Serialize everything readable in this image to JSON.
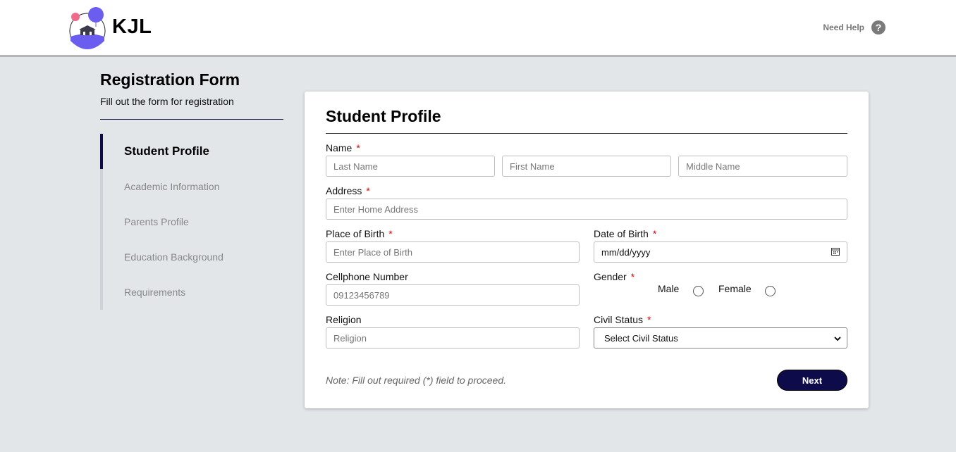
{
  "header": {
    "brand": "KJL",
    "help_label": "Need Help",
    "help_icon_glyph": "?"
  },
  "sidebar": {
    "title": "Registration Form",
    "subtitle": "Fill out the form for registration",
    "steps": [
      {
        "label": "Student Profile",
        "active": true
      },
      {
        "label": "Academic Information",
        "active": false
      },
      {
        "label": "Parents Profile",
        "active": false
      },
      {
        "label": "Education Background",
        "active": false
      },
      {
        "label": "Requirements",
        "active": false
      }
    ]
  },
  "form": {
    "title": "Student Profile",
    "required_mark": "*",
    "name": {
      "label": "Name",
      "last_placeholder": "Last Name",
      "first_placeholder": "First Name",
      "middle_placeholder": "Middle Name"
    },
    "address": {
      "label": "Address",
      "placeholder": "Enter Home Address"
    },
    "place_of_birth": {
      "label": "Place of Birth",
      "placeholder": "Enter Place of Birth"
    },
    "date_of_birth": {
      "label": "Date of Birth",
      "value": "mm/dd/yyyy",
      "icon": "calendar-icon"
    },
    "cellphone": {
      "label": "Cellphone Number",
      "placeholder": "09123456789"
    },
    "gender": {
      "label": "Gender",
      "options": [
        "Male",
        "Female"
      ]
    },
    "religion": {
      "label": "Religion",
      "placeholder": "Religion"
    },
    "civil_status": {
      "label": "Civil Status",
      "selected": "Select Civil Status",
      "icon": "chevron-down-icon"
    },
    "note": "Note: Fill out required (*) field to proceed.",
    "next_label": "Next"
  },
  "colors": {
    "accent": "#0e0b4a",
    "required": "#dd0000",
    "background": "#e2e6e9"
  }
}
